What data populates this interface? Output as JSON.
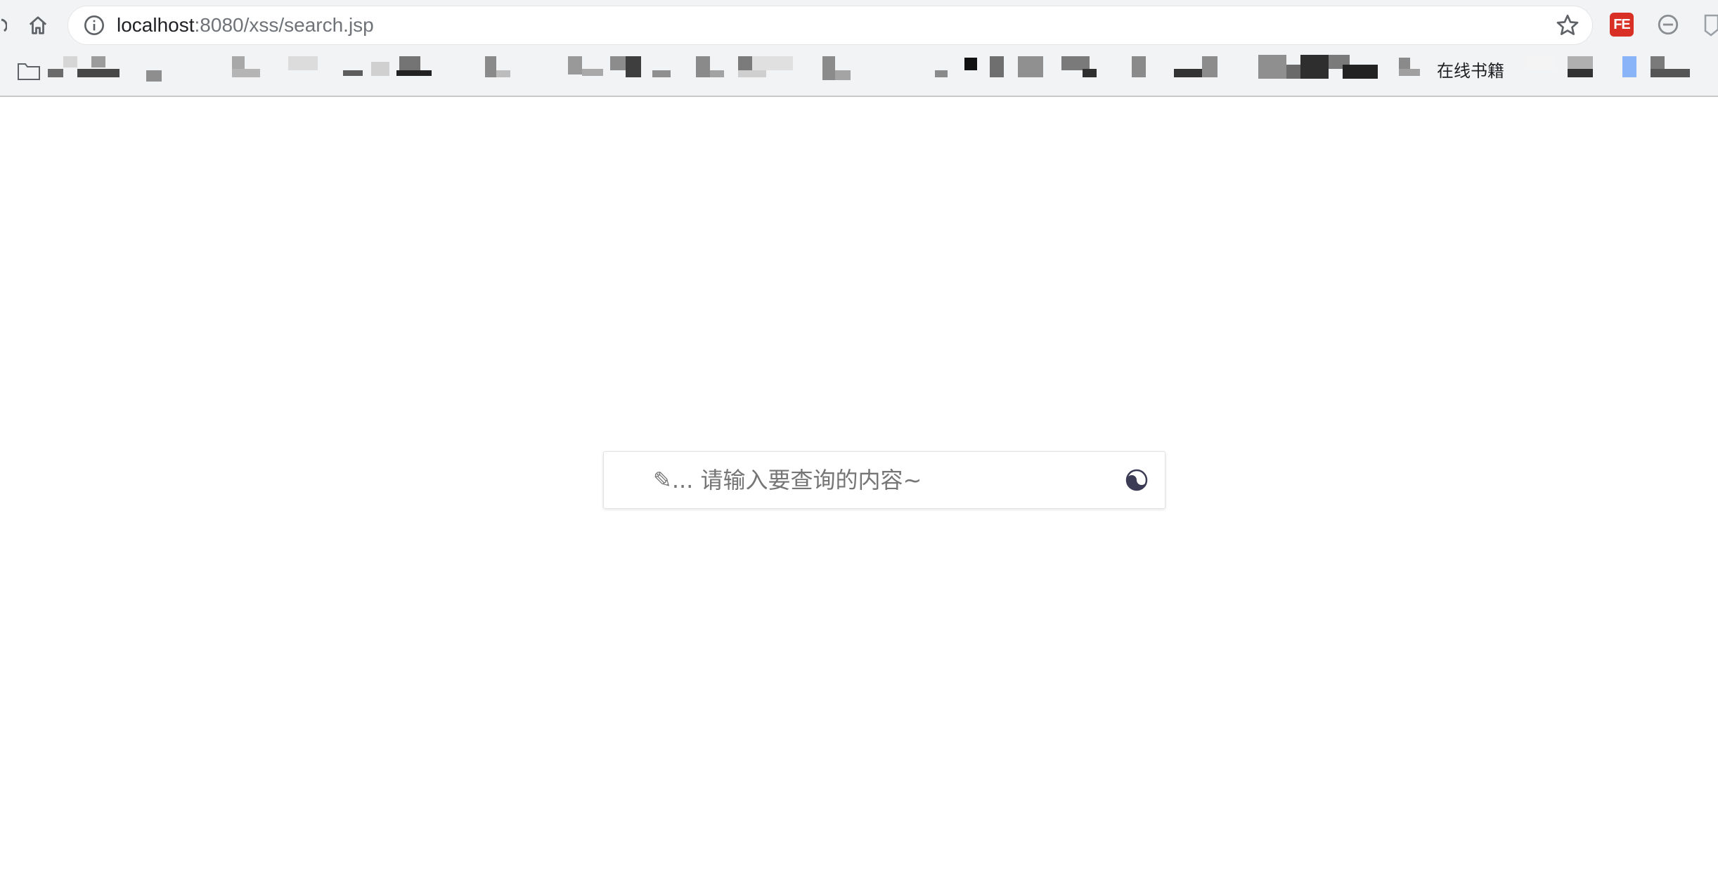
{
  "browser": {
    "address_bar": {
      "host": "localhost",
      "path": ":8080/xss/search.jsp"
    },
    "icons": {
      "home": "home-icon",
      "info": "info-icon",
      "star": "star-icon",
      "extension_fe": "fe-extension-icon",
      "extension_block": "minus-circle-icon",
      "extension_shield": "shield-icon"
    },
    "extension_fe_label": "FE",
    "bookmarks": {
      "folder_icon": "folder-icon",
      "visible_label": "在线书籍"
    }
  },
  "search": {
    "placeholder": "✎... 请输入要查询的内容~",
    "value": "",
    "submit_icon": "yin-yang-icon"
  },
  "colors": {
    "chrome_bg": "#f1f3f4",
    "fe_red": "#d93025",
    "search_icon": "#3b3b55"
  }
}
